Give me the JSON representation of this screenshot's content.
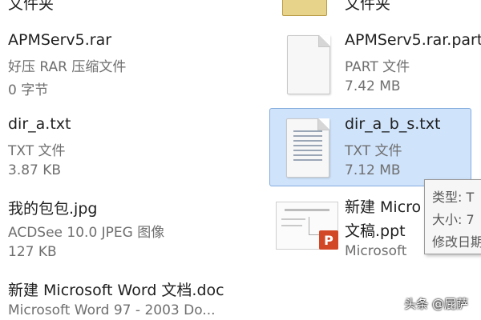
{
  "files_left": [
    {
      "name": "文件夹",
      "type": "",
      "size": ""
    },
    {
      "name": "APMServ5.rar",
      "type": "好压 RAR 压缩文件",
      "size": "0 字节"
    },
    {
      "name": "dir_a.txt",
      "type": "TXT 文件",
      "size": "3.87 KB"
    },
    {
      "name": "我的包包.jpg",
      "type": "ACDSee 10.0 JPEG 图像",
      "size": "127 KB"
    },
    {
      "name": "新建 Microsoft Word 文档.doc",
      "type": "Microsoft Word 97 - 2003 Do...",
      "size": ""
    }
  ],
  "files_right": [
    {
      "name": "文件夹",
      "type": "",
      "size": ""
    },
    {
      "name": "APMServ5.rar.part",
      "type": "PART 文件",
      "size": "7.42 MB"
    },
    {
      "name": "dir_a_b_s.txt",
      "type": "TXT 文件",
      "size": "7.12 MB"
    },
    {
      "name": "新建 Micro",
      "name2": "文稿.ppt",
      "type": "Microsoft",
      "size": ""
    }
  ],
  "tooltip": {
    "type_label": "类型: T",
    "size_label": "大小: 7",
    "date_label": "修改日期"
  },
  "ppt_badge": "P",
  "watermark": "头条 @屁萨",
  "icons": {
    "folder": "folder-icon",
    "part_file": "document-icon",
    "txt_file": "text-document-icon",
    "ppt_file": "powerpoint-icon"
  }
}
